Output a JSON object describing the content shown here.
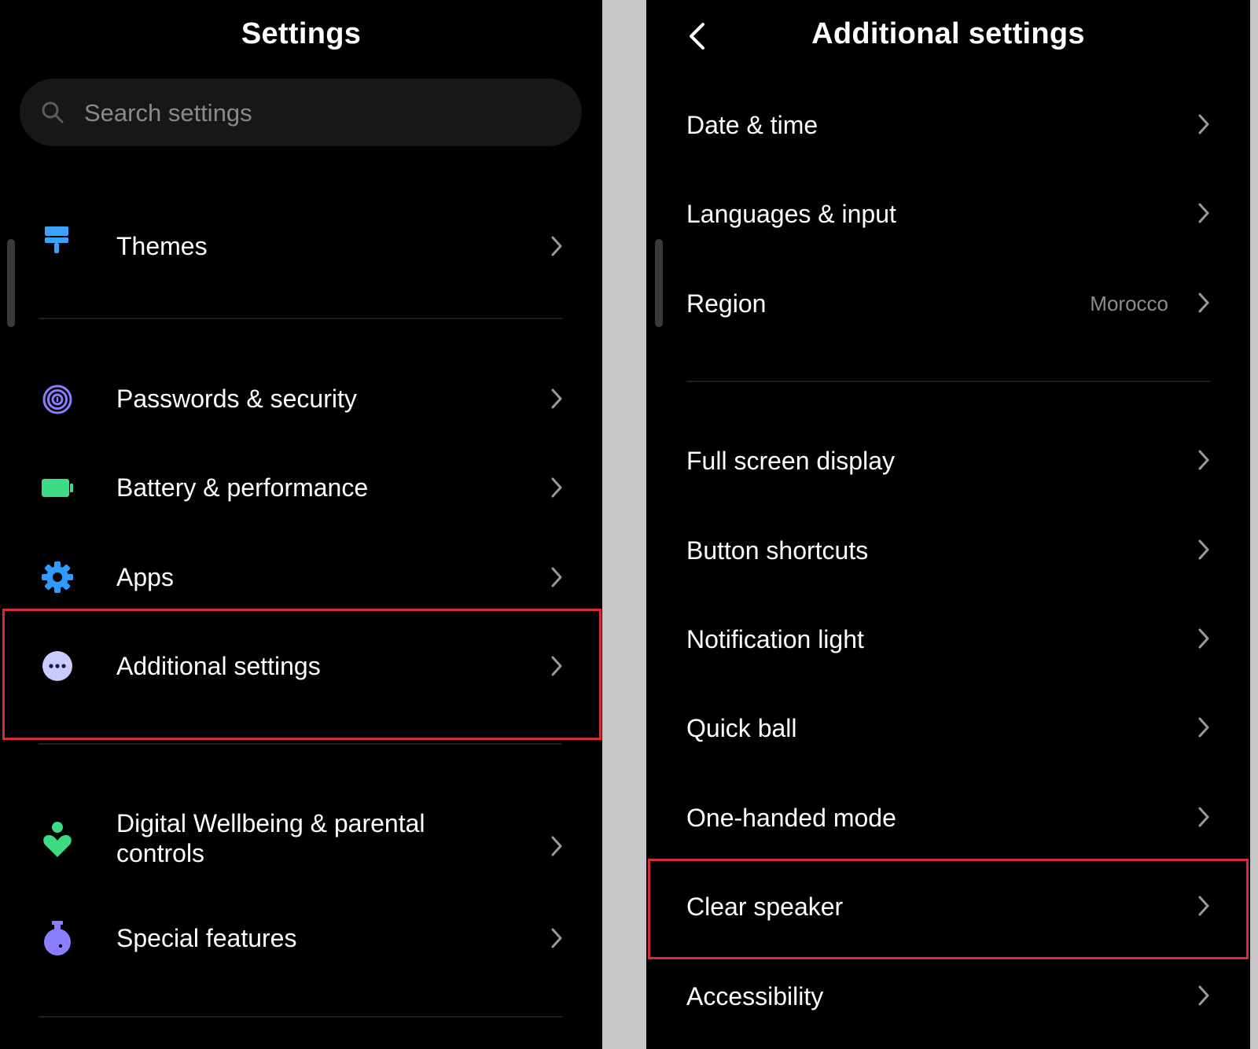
{
  "left": {
    "title": "Settings",
    "search": {
      "placeholder": "Search settings"
    },
    "items": [
      {
        "label": "Themes",
        "icon": "paint-brush-icon",
        "color": "#3aa3ff"
      },
      {
        "label": "Passwords & security",
        "icon": "fingerprint-icon",
        "color": "#8b7dff"
      },
      {
        "label": "Battery & performance",
        "icon": "battery-icon",
        "color": "#3ddc84"
      },
      {
        "label": "Apps",
        "icon": "gear-icon",
        "color": "#2f9bff"
      },
      {
        "label": "Additional settings",
        "icon": "more-dots-icon",
        "color": "#c9cbff",
        "highlighted": true
      },
      {
        "label": "Digital Wellbeing & parental",
        "label2": "controls",
        "icon": "heart-person-icon",
        "color": "#3ddc84"
      },
      {
        "label": "Special features",
        "icon": "flask-icon",
        "color": "#8b7dff"
      }
    ]
  },
  "right": {
    "title": "Additional settings",
    "back_icon": "back-arrow-icon",
    "items": [
      {
        "label": "Date & time"
      },
      {
        "label": "Languages & input"
      },
      {
        "label": "Region",
        "value": "Morocco"
      },
      {
        "label": "Full screen display"
      },
      {
        "label": "Button shortcuts"
      },
      {
        "label": "Notification light"
      },
      {
        "label": "Quick ball"
      },
      {
        "label": "One-handed mode"
      },
      {
        "label": "Clear speaker",
        "highlighted": true
      },
      {
        "label": "Accessibility"
      }
    ]
  },
  "colors": {
    "background": "#000000",
    "highlight": "#d62c35",
    "secondary_text": "#8c8c8c"
  }
}
